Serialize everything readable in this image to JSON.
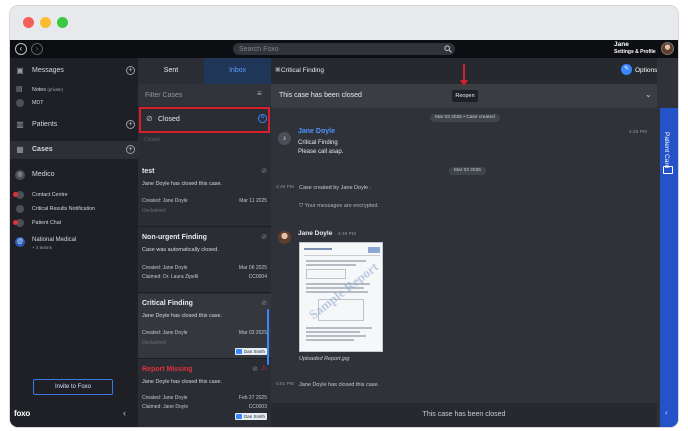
{
  "window": {
    "colors": {
      "close": "#f25f58",
      "minimize": "#f9be2f",
      "maximize": "#3ac840"
    }
  },
  "topbar": {
    "search_placeholder": "Search Foxo",
    "user_name": "Jane",
    "user_sub": "Settings & Profile"
  },
  "sidebar": {
    "items": [
      {
        "label": "Messages",
        "icon": "messages-icon"
      },
      {
        "label": "Notes",
        "sub": "(private)",
        "icon": "notes-icon"
      },
      {
        "label": "MDT",
        "icon": "mdt-icon"
      },
      {
        "label": "Patients",
        "icon": "patients-icon"
      },
      {
        "label": "Cases",
        "icon": "cases-icon"
      },
      {
        "label": "Medico",
        "icon": "medico-icon"
      },
      {
        "label": "Contact Centre"
      },
      {
        "label": "Critical Results Notification"
      },
      {
        "label": "Patient Chat"
      },
      {
        "label": "National Medical",
        "sub": "+ 3 teams"
      }
    ],
    "invite_label": "Invite to Foxo",
    "logo": "foxo"
  },
  "list": {
    "tabs": [
      "Sent",
      "Inbox"
    ],
    "filter_placeholder": "Filter Cases",
    "filter_chip": "Closed",
    "ghost_closed": "Closed",
    "cards": [
      {
        "title": "test",
        "msg": "Jane Doyle has closed this case.",
        "created": "Created: Jane Doyle",
        "date": "Mar 11 2025",
        "faint": "Unclaimed"
      },
      {
        "title": "Non-urgent Finding",
        "msg": "Case was automatically closed.",
        "created": "Created: Jane Doyle",
        "claimed": "Claimed: Dr. Laura Zipelli",
        "date": "Mar 06 2025",
        "code": "CC0004"
      },
      {
        "title": "Critical Finding",
        "msg": "Jane Doyle has closed this case.",
        "created": "Created: Jane Doyle",
        "date": "Mar 03 2025",
        "faint": "Unclaimed",
        "chip": "Dan Smith"
      },
      {
        "title": "Report Missing",
        "msg": "Jane Doyle has closed this case.",
        "created": "Created: Jane Doyle",
        "claimed": "Claimed: Jane Doyle",
        "date": "Feb 27 2025",
        "code": "CC0003",
        "chip": "Dan Smith"
      }
    ]
  },
  "conversation": {
    "title": "Critical Finding",
    "options_label": "Options",
    "banner": "This case has been closed",
    "reopen_label": "Reopen",
    "date1": "Mar 03 2025 • Case created",
    "sender1": "Jane Doyle",
    "time1": "4:46 PM",
    "msg1_line1": "Critical Finding",
    "msg1_line2": "Please call asap.",
    "date2": "Mar 03 2025",
    "sys_time1": "4:46 PM",
    "sys1": "Case created by Jane Doyle .",
    "encrypted": "Your messages are encrypted.",
    "sender2": "Jane Doyle",
    "time2": "4:46 PM",
    "watermark": "Sample Report",
    "caption": "Uploaded Report.jpg",
    "sys_time2": "4:51 PM",
    "sys2": "Jane Doyle has closed this case.",
    "footer": "This case has been closed"
  },
  "rail": {
    "label": "Patient Card"
  }
}
